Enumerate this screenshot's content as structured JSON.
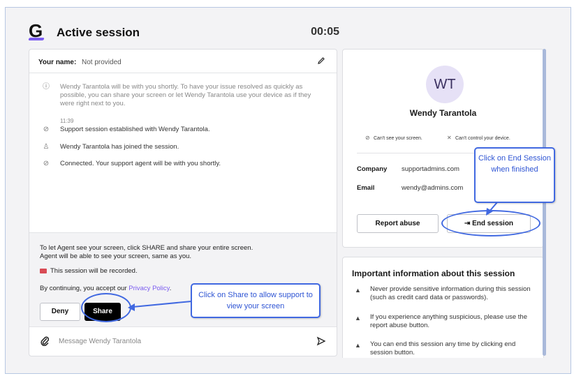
{
  "header": {
    "logo_letter": "G",
    "title": "Active session",
    "timer": "00:05"
  },
  "chat": {
    "name_label": "Your name:",
    "name_value": "Not provided",
    "info_message": "Wendy Tarantola will be with you shortly. To have your issue resolved as quickly as possible, you can share your screen or let Wendy Tarantola use your device as if they were right next to you.",
    "timestamp": "11:39",
    "events": [
      "Support session established with Wendy Tarantola.",
      "Wendy Tarantola has joined the session.",
      "Connected. Your support agent will be with you shortly."
    ],
    "share_prompt_line1": "To let Agent see your screen, click SHARE and share your entire screen.",
    "share_prompt_line2": "Agent will be able to see your screen, same as you.",
    "recorded_notice": "This session will be recorded.",
    "accept_prefix": "By continuing, you accept our ",
    "privacy_link": "Privacy Policy",
    "accept_suffix": ".",
    "deny_label": "Deny",
    "share_label": "Share",
    "message_placeholder": "Message Wendy Tarantola"
  },
  "agent": {
    "initials": "WT",
    "name": "Wendy Tarantola",
    "perm_screen": "Can't see your screen.",
    "perm_control": "Can't control your device.",
    "company_label": "Company",
    "company_value": "supportadmins.com",
    "email_label": "Email",
    "email_value": "wendy@admins.com",
    "report_label": "Report abuse",
    "end_label": "End session"
  },
  "info": {
    "title": "Important information about this session",
    "items": [
      "Never provide sensitive information during this session (such as credit card data or passwords).",
      "If you experience anything suspicious, please use the report abuse button.",
      "You can end this session any time by clicking end session button."
    ]
  },
  "callouts": {
    "end": "Click on End Session when finished",
    "share": "Click on Share to allow support to view your screen"
  },
  "colors": {
    "accent": "#7b5cf0",
    "callout": "#4169e1",
    "record": "#d84b55"
  }
}
